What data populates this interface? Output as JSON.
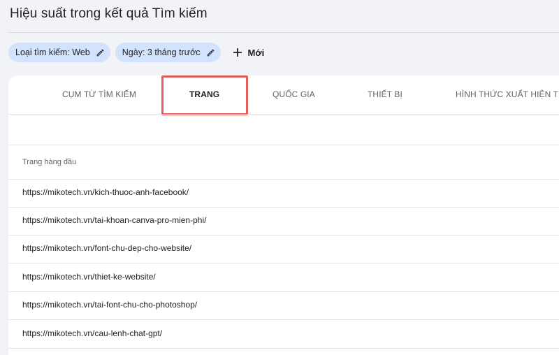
{
  "header": {
    "title": "Hiệu suất trong kết quả Tìm kiếm"
  },
  "filters": {
    "chips": [
      {
        "label": "Loại tìm kiếm: Web",
        "icon": "pencil-icon"
      },
      {
        "label": "Ngày: 3 tháng trước",
        "icon": "pencil-icon"
      }
    ],
    "new_label": "Mới",
    "new_icon": "plus-icon",
    "chip_color": "#d3e3fd"
  },
  "tabs": [
    {
      "label": "CỤM TỪ TÌM KIẾM",
      "active": false
    },
    {
      "label": "TRANG",
      "active": true
    },
    {
      "label": "QUỐC GIA",
      "active": false
    },
    {
      "label": "THIẾT BỊ",
      "active": false
    },
    {
      "label": "HÌNH THỨC XUẤT HIỆN TRÊN KẾT QUẢ TÌM KIẾM",
      "active": false
    }
  ],
  "highlight_color": "#e35d5b",
  "table": {
    "column_header": "Trang hàng đầu",
    "rows": [
      "https://mikotech.vn/kich-thuoc-anh-facebook/",
      "https://mikotech.vn/tai-khoan-canva-pro-mien-phi/",
      "https://mikotech.vn/font-chu-dep-cho-website/",
      "https://mikotech.vn/thiet-ke-website/",
      "https://mikotech.vn/tai-font-chu-cho-photoshop/",
      "https://mikotech.vn/cau-lenh-chat-gpt/"
    ]
  }
}
